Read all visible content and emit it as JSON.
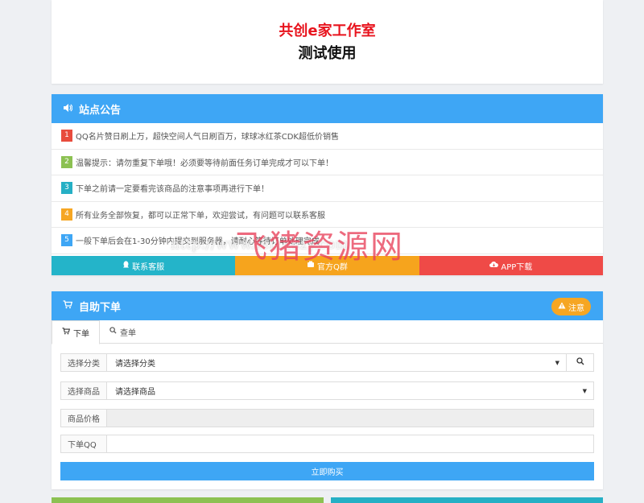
{
  "header": {
    "site_name": "共创e家工作室",
    "site_sub": "测试使用"
  },
  "notice": {
    "title": "站点公告",
    "items": [
      {
        "num": "1",
        "text": "QQ名片赞日刷上万，超快空间人气日刷百万，球球冰红茶CDK超低价销售"
      },
      {
        "num": "2",
        "text": "温馨提示：请勿重复下单哦！必须要等待前面任务订单完成才可以下单！"
      },
      {
        "num": "3",
        "text": "下单之前请一定要看完该商品的注意事项再进行下单！"
      },
      {
        "num": "4",
        "text": "所有业务全部恢复，都可以正常下单，欢迎尝试，有问题可以联系客服"
      },
      {
        "num": "5",
        "text": "一般下单后会在1-30分钟内提交到服务器，请耐心等待订单处理完成"
      }
    ],
    "links": {
      "contact": "联系客服",
      "group": "官方Q群",
      "app": "APP下载"
    }
  },
  "order": {
    "title": "自助下单",
    "notice_btn": "注意",
    "tabs": {
      "order": "下单",
      "query": "查单"
    },
    "fields": {
      "category_label": "选择分类",
      "category_value": "请选择分类",
      "product_label": "选择商品",
      "product_value": "请选择商品",
      "price_label": "商品价格",
      "price_value": "",
      "qq_label": "下单QQ",
      "qq_value": ""
    },
    "buy_btn": "立即购买"
  },
  "watermark": {
    "main": "飞猪资源网",
    "url": "http://www.feizhuzy.com"
  },
  "colors": {
    "primary": "#3ea6f5",
    "red": "#e8131d",
    "orange": "#f6a623",
    "green": "#8cc152",
    "teal": "#26b0c5"
  },
  "icons": {
    "notice": "volume-icon",
    "cart": "cart-icon",
    "search": "search-icon",
    "warning": "warning-icon",
    "qq": "qq-icon",
    "cloud": "cloud-download-icon"
  }
}
